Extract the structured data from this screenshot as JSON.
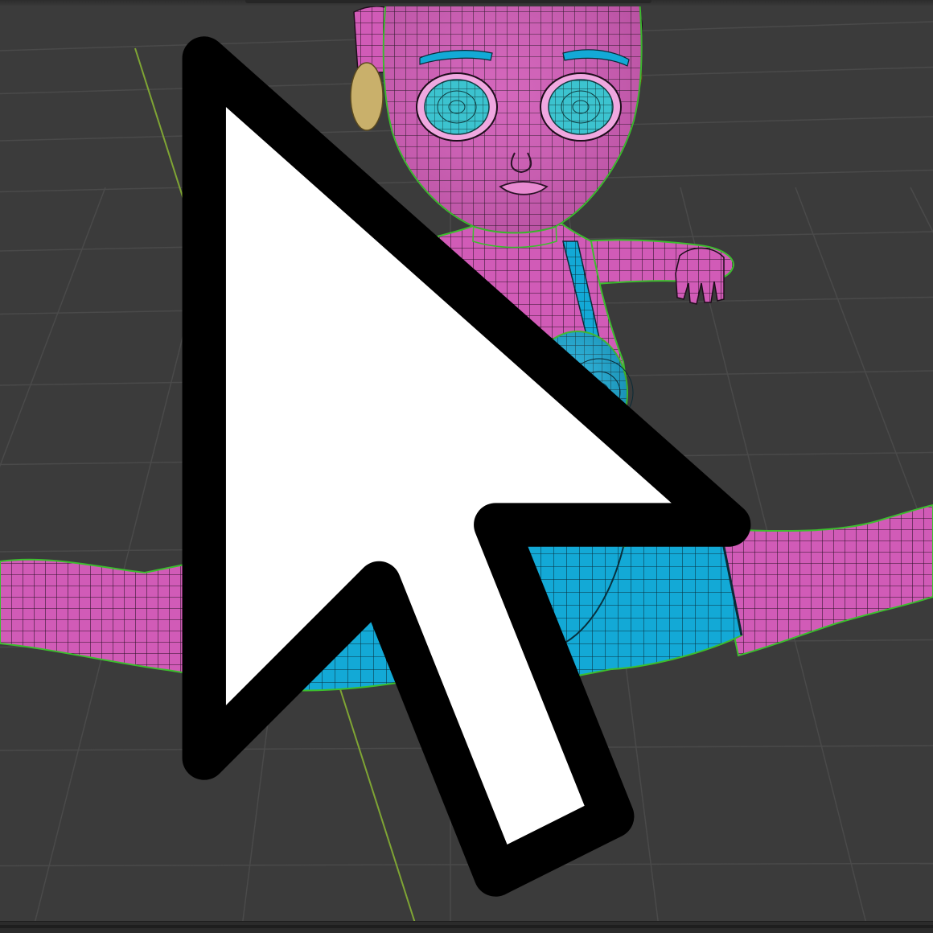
{
  "viewport": {
    "name": "3D viewport",
    "background_color": "#3b3b3b",
    "grid_line_color": "#4a4a4a",
    "y_axis_color": "#7fa534"
  },
  "model": {
    "skin_color": "#d15bb7",
    "clothing_color": "#13a9d6",
    "eye_color": "#3cc3cf",
    "ornament_color": "#c9b06b",
    "wire_color": "#1a1a1a",
    "outline_color": "#3cbe2e"
  },
  "cursor": {
    "icon": "mouse-pointer-icon"
  }
}
